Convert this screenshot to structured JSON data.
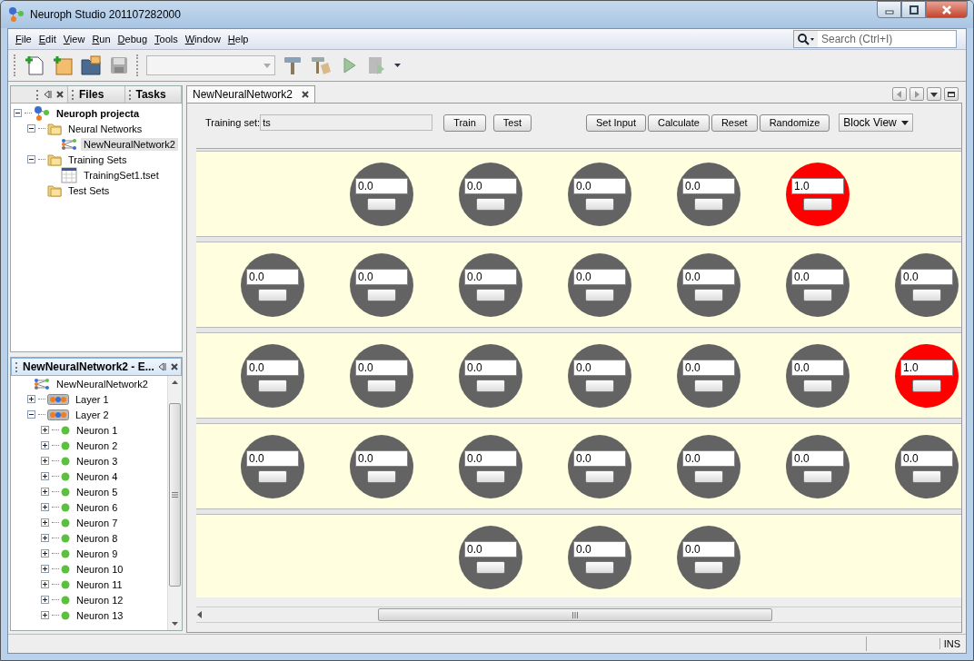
{
  "window": {
    "title": "Neuroph Studio 201107282000"
  },
  "menu": [
    {
      "label": "File"
    },
    {
      "label": "Edit"
    },
    {
      "label": "View"
    },
    {
      "label": "Run"
    },
    {
      "label": "Debug"
    },
    {
      "label": "Tools"
    },
    {
      "label": "Window"
    },
    {
      "label": "Help"
    }
  ],
  "search": {
    "placeholder": "Search (Ctrl+I)"
  },
  "left_tabs": [
    {
      "label": "Files"
    },
    {
      "label": "Tasks"
    }
  ],
  "project_tree": {
    "kind": "project",
    "label": "Neuroph projecta",
    "expanded": true,
    "selected": false,
    "children": [
      {
        "kind": "folder",
        "label": "Neural Networks",
        "expanded": true,
        "selected": false,
        "children": [
          {
            "kind": "network",
            "label": "NewNeuralNetwork2",
            "selected": true
          }
        ]
      },
      {
        "kind": "folder",
        "label": "Training Sets",
        "expanded": true,
        "selected": false,
        "children": [
          {
            "kind": "trainingset",
            "label": "TrainingSet1.tset",
            "selected": false
          }
        ]
      },
      {
        "kind": "folder",
        "label": "Test Sets",
        "selected": false
      }
    ]
  },
  "navigator": {
    "title": "NewNeuralNetwork2 - E...",
    "tree": {
      "kind": "network",
      "label": "NewNeuralNetwork2",
      "children": [
        {
          "kind": "layer",
          "label": "Layer 1",
          "expanded": false
        },
        {
          "kind": "layer",
          "label": "Layer 2",
          "expanded": true,
          "children": [
            {
              "kind": "neuron",
              "label": "Neuron 1",
              "expanded": false
            },
            {
              "kind": "neuron",
              "label": "Neuron 2",
              "expanded": false
            },
            {
              "kind": "neuron",
              "label": "Neuron 3",
              "expanded": false
            },
            {
              "kind": "neuron",
              "label": "Neuron 4",
              "expanded": false
            },
            {
              "kind": "neuron",
              "label": "Neuron 5",
              "expanded": false
            },
            {
              "kind": "neuron",
              "label": "Neuron 6",
              "expanded": false
            },
            {
              "kind": "neuron",
              "label": "Neuron 7",
              "expanded": false
            },
            {
              "kind": "neuron",
              "label": "Neuron 8",
              "expanded": false
            },
            {
              "kind": "neuron",
              "label": "Neuron 9",
              "expanded": false
            },
            {
              "kind": "neuron",
              "label": "Neuron 10",
              "expanded": false
            },
            {
              "kind": "neuron",
              "label": "Neuron 11",
              "expanded": false
            },
            {
              "kind": "neuron",
              "label": "Neuron 12",
              "expanded": false
            },
            {
              "kind": "neuron",
              "label": "Neuron 13",
              "expanded": false
            }
          ]
        }
      ]
    }
  },
  "editor": {
    "tab": {
      "label": "NewNeuralNetwork2"
    },
    "training_set": {
      "label": "Training set:",
      "value": "ts"
    },
    "buttons_left": [
      "Train",
      "Test"
    ],
    "buttons_right": [
      "Set Input",
      "Calculate",
      "Reset",
      "Randomize"
    ],
    "view_select": {
      "value": "Block View"
    },
    "layers": [
      {
        "neurons": [
          {
            "value": "0.0",
            "active": false
          },
          {
            "value": "0.0",
            "active": false
          },
          {
            "value": "0.0",
            "active": false
          },
          {
            "value": "0.0",
            "active": false
          },
          {
            "value": "1.0",
            "active": true
          }
        ]
      },
      {
        "neurons": [
          {
            "value": "0.0",
            "active": false
          },
          {
            "value": "0.0",
            "active": false
          },
          {
            "value": "0.0",
            "active": false
          },
          {
            "value": "0.0",
            "active": false
          },
          {
            "value": "0.0",
            "active": false
          },
          {
            "value": "0.0",
            "active": false
          },
          {
            "value": "0.0",
            "active": false
          }
        ]
      },
      {
        "neurons": [
          {
            "value": "0.0",
            "active": false
          },
          {
            "value": "0.0",
            "active": false
          },
          {
            "value": "0.0",
            "active": false
          },
          {
            "value": "0.0",
            "active": false
          },
          {
            "value": "0.0",
            "active": false
          },
          {
            "value": "0.0",
            "active": false
          },
          {
            "value": "1.0",
            "active": true
          }
        ]
      },
      {
        "neurons": [
          {
            "value": "0.0",
            "active": false
          },
          {
            "value": "0.0",
            "active": false
          },
          {
            "value": "0.0",
            "active": false
          },
          {
            "value": "0.0",
            "active": false
          },
          {
            "value": "0.0",
            "active": false
          },
          {
            "value": "0.0",
            "active": false
          },
          {
            "value": "0.0",
            "active": false
          }
        ]
      },
      {
        "neurons": [
          {
            "value": "0.0",
            "active": false
          },
          {
            "value": "0.0",
            "active": false
          },
          {
            "value": "0.0",
            "active": false
          }
        ]
      }
    ]
  },
  "status_bar": {
    "mode": "INS"
  }
}
